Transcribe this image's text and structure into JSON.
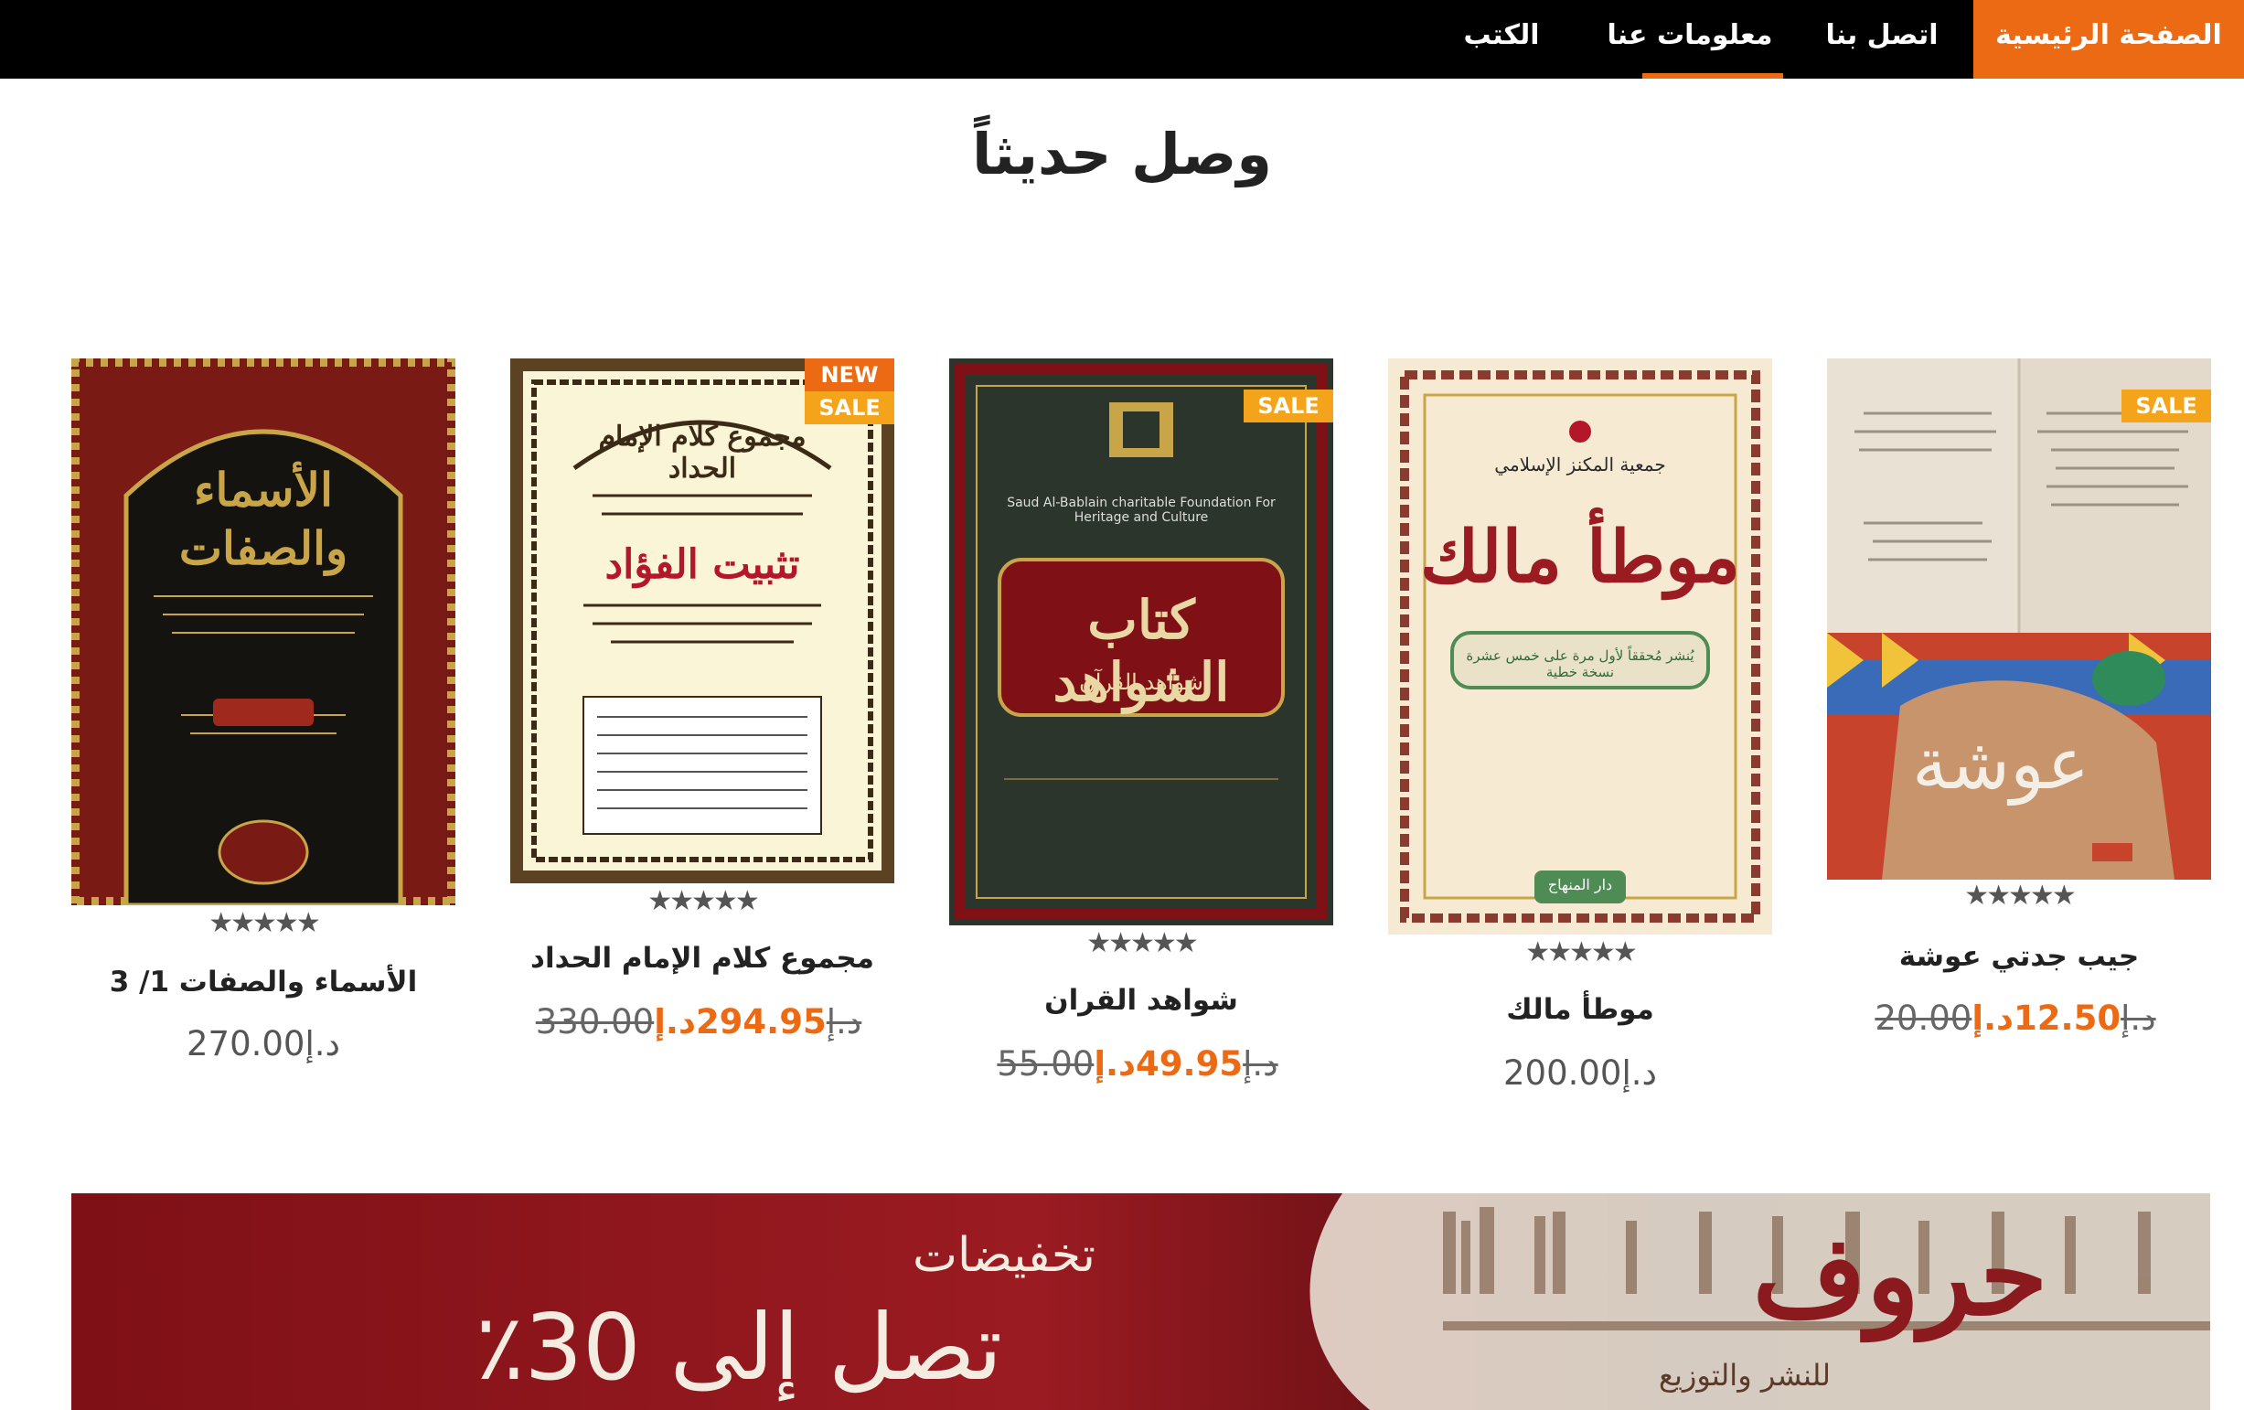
{
  "nav": {
    "items": [
      {
        "label": "الصفحة الرئيسية",
        "active": true
      },
      {
        "label": "اتصل بنا",
        "active": false
      },
      {
        "label": "معلومات عنا",
        "active": false
      },
      {
        "label": "الكتب",
        "active": false
      }
    ],
    "accent_color": "#ec6a13"
  },
  "section_title": "وصل حديثاً",
  "products": [
    {
      "title": "جيب جدتي عوشة",
      "badges": [
        "SALE"
      ],
      "rating": 5,
      "old_price": "20.00د.إ",
      "price": "12.50د.إ",
      "cover": {
        "title": "عوشة",
        "colors": [
          "#e8dfd2",
          "#3a6bb8",
          "#c8432b"
        ]
      }
    },
    {
      "title": "موطأ مالك",
      "badges": [],
      "rating": 5,
      "old_price": "",
      "price": "200.00د.إ",
      "cover": {
        "title": "موطأ مالك",
        "publisher_top": "جمعية المكنز الإسلامي",
        "subtitle": "يُنشر مُحققاً لأول مرة على خمس عشرة نسخة خطية",
        "publisher_bottom": "دار المنهاج",
        "colors": [
          "#f6ead3",
          "#9b1b22",
          "#4f8b54"
        ]
      }
    },
    {
      "title": "شواهد القران",
      "badges": [
        "SALE"
      ],
      "rating": 5,
      "old_price": "55.00د.إ",
      "price": "49.95د.إ",
      "cover": {
        "title": "كتاب الشواهد",
        "subtitle": "شواهد القرآن",
        "foundation_en": "Saud Al-Bablain charitable Foundation For Heritage and Culture",
        "colors": [
          "#2e3a2e",
          "#7e1016",
          "#c9a54a"
        ]
      }
    },
    {
      "title": "مجموع كلام الإمام الحداد",
      "badges": [
        "NEW",
        "SALE"
      ],
      "rating": 5,
      "old_price": "330.00د.إ",
      "price": "294.95د.إ",
      "cover": {
        "title": "تثبيت الفؤاد",
        "top": "مجموع كلام الإمام الحداد",
        "colors": [
          "#fbf5d8",
          "#3b2a16",
          "#b5172a"
        ]
      }
    },
    {
      "title": "الأسماء والصفات 1/ 3",
      "badges": [],
      "rating": 5,
      "old_price": "",
      "price": "270.00د.إ",
      "cover": {
        "title": "الأسماء والصفات",
        "colors": [
          "#12110f",
          "#c9a54a",
          "#7a1a14"
        ]
      }
    }
  ],
  "banner": {
    "line1": "تخفيضات",
    "line2": "تصل إلى 30٪",
    "brand": "حروف",
    "brand_sub": "للنشر والتوزيع"
  }
}
